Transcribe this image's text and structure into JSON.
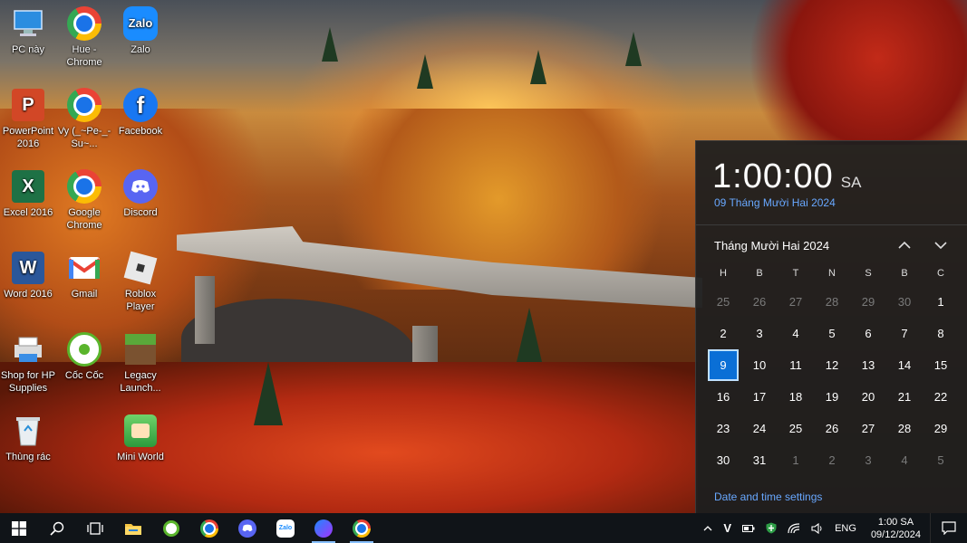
{
  "desktop": {
    "icons": [
      {
        "label": "PC này",
        "icon": "this-pc-icon"
      },
      {
        "label": "Hue - Chrome",
        "icon": "chrome-icon"
      },
      {
        "label": "Zalo",
        "icon": "zalo-icon"
      },
      {
        "label": "PowerPoint 2016",
        "icon": "powerpoint-icon"
      },
      {
        "label": "Vy (_~Pe-_-Su~...",
        "icon": "chrome-icon"
      },
      {
        "label": "Facebook",
        "icon": "facebook-icon"
      },
      {
        "label": "Excel 2016",
        "icon": "excel-icon"
      },
      {
        "label": "Google Chrome",
        "icon": "chrome-icon"
      },
      {
        "label": "Discord",
        "icon": "discord-icon"
      },
      {
        "label": "Word 2016",
        "icon": "word-icon"
      },
      {
        "label": "Gmail",
        "icon": "gmail-icon"
      },
      {
        "label": "Roblox Player",
        "icon": "roblox-icon"
      },
      {
        "label": "Shop for HP Supplies",
        "icon": "hp-printer-icon"
      },
      {
        "label": "Cốc Cốc",
        "icon": "coccoc-icon"
      },
      {
        "label": "Legacy Launch...",
        "icon": "minecraft-icon"
      },
      {
        "label": "Thùng rác",
        "icon": "recycle-bin-icon"
      },
      {
        "label": "Mini World",
        "icon": "mini-world-icon"
      }
    ],
    "logo_text": {
      "zalo": "Zalo",
      "facebook": "f",
      "powerpoint": "P",
      "excel": "X",
      "word": "W",
      "gmail": "M"
    }
  },
  "calendar": {
    "time": "1:00:00",
    "ampm": "SA",
    "long_date": "09 Tháng Mười Hai 2024",
    "month_label": "Tháng Mười Hai 2024",
    "weekdays": [
      "H",
      "B",
      "T",
      "N",
      "S",
      "B",
      "C"
    ],
    "weeks": [
      [
        {
          "d": "25",
          "m": true
        },
        {
          "d": "26",
          "m": true
        },
        {
          "d": "27",
          "m": true
        },
        {
          "d": "28",
          "m": true
        },
        {
          "d": "29",
          "m": true
        },
        {
          "d": "30",
          "m": true
        },
        {
          "d": "1"
        }
      ],
      [
        {
          "d": "2"
        },
        {
          "d": "3"
        },
        {
          "d": "4"
        },
        {
          "d": "5"
        },
        {
          "d": "6"
        },
        {
          "d": "7"
        },
        {
          "d": "8"
        }
      ],
      [
        {
          "d": "9",
          "today": true
        },
        {
          "d": "10"
        },
        {
          "d": "11"
        },
        {
          "d": "12"
        },
        {
          "d": "13"
        },
        {
          "d": "14"
        },
        {
          "d": "15"
        }
      ],
      [
        {
          "d": "16"
        },
        {
          "d": "17"
        },
        {
          "d": "18"
        },
        {
          "d": "19"
        },
        {
          "d": "20"
        },
        {
          "d": "21"
        },
        {
          "d": "22"
        }
      ],
      [
        {
          "d": "23"
        },
        {
          "d": "24"
        },
        {
          "d": "25"
        },
        {
          "d": "26"
        },
        {
          "d": "27"
        },
        {
          "d": "28"
        },
        {
          "d": "29"
        }
      ],
      [
        {
          "d": "30"
        },
        {
          "d": "31"
        },
        {
          "d": "1",
          "m": true
        },
        {
          "d": "2",
          "m": true
        },
        {
          "d": "3",
          "m": true
        },
        {
          "d": "4",
          "m": true
        },
        {
          "d": "5",
          "m": true
        }
      ]
    ],
    "settings_link": "Date and time settings",
    "accent_color": "#0a6fd6",
    "link_color": "#68a8ff"
  },
  "taskbar": {
    "pinned": [
      {
        "name": "start-button",
        "icon": "windows-icon"
      },
      {
        "name": "search-button",
        "icon": "search-icon"
      },
      {
        "name": "task-view-button",
        "icon": "task-view-icon"
      },
      {
        "name": "file-explorer-button",
        "icon": "folder-icon"
      },
      {
        "name": "coccoc-button",
        "icon": "coccoc-icon"
      },
      {
        "name": "chrome-button",
        "icon": "chrome-icon"
      },
      {
        "name": "discord-button",
        "icon": "discord-icon"
      },
      {
        "name": "zalo-button",
        "icon": "zalo-icon"
      },
      {
        "name": "messenger-button",
        "icon": "messenger-icon",
        "active": true
      },
      {
        "name": "chrome-profile-button",
        "icon": "chrome-icon",
        "active": true
      }
    ],
    "tray": {
      "v_label": "V",
      "language": "ENG",
      "clock_time": "1:00 SA",
      "clock_date": "09/12/2024"
    }
  }
}
